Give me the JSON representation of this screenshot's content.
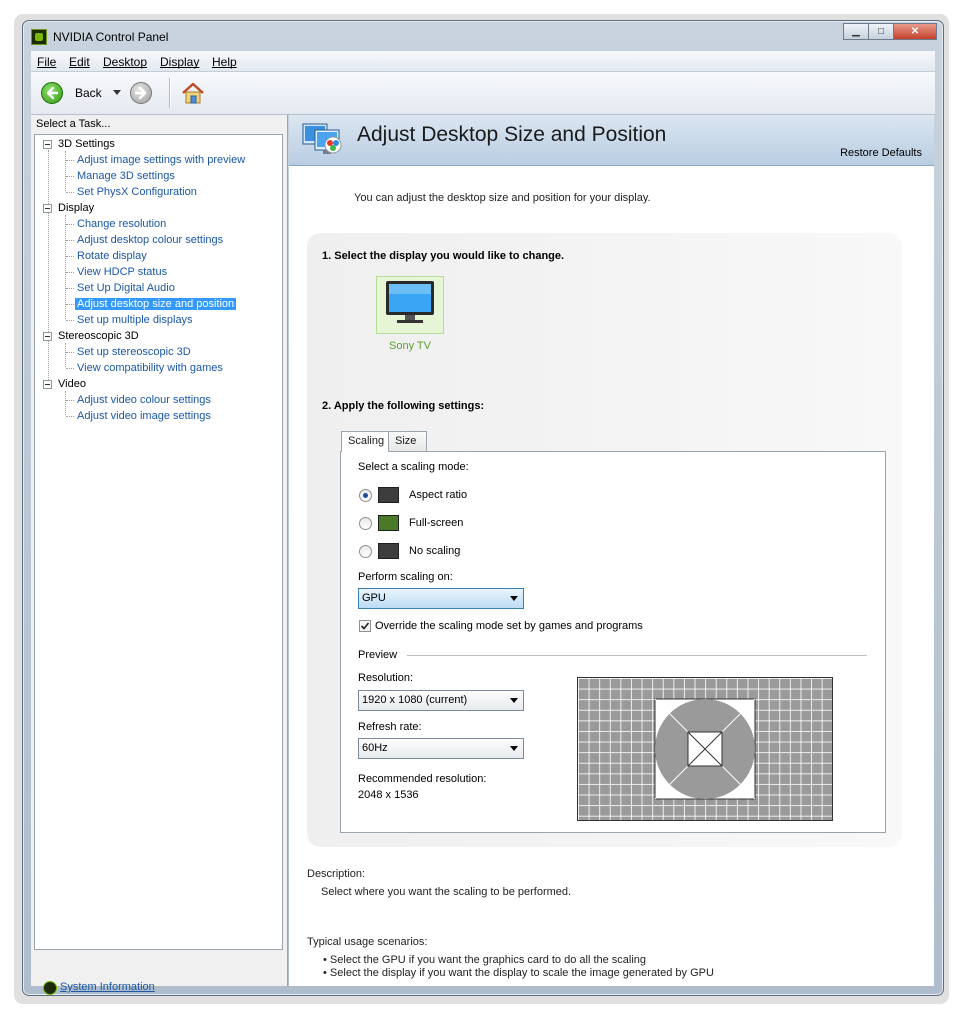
{
  "window": {
    "title": "NVIDIA Control Panel"
  },
  "menu": [
    "File",
    "Edit",
    "Desktop",
    "Display",
    "Help"
  ],
  "toolbar": {
    "back_label": "Back"
  },
  "sidebar": {
    "header": "Select a Task...",
    "categories": [
      {
        "label": "3D Settings",
        "items": [
          "Adjust image settings with preview",
          "Manage 3D settings",
          "Set PhysX Configuration"
        ]
      },
      {
        "label": "Display",
        "items": [
          "Change resolution",
          "Adjust desktop colour settings",
          "Rotate display",
          "View HDCP status",
          "Set Up Digital Audio",
          "Adjust desktop size and position",
          "Set up multiple displays"
        ]
      },
      {
        "label": "Stereoscopic 3D",
        "items": [
          "Set up stereoscopic 3D",
          "View compatibility with games"
        ]
      },
      {
        "label": "Video",
        "items": [
          "Adjust video colour settings",
          "Adjust video image settings"
        ]
      }
    ],
    "selected": "Adjust desktop size and position",
    "system_info": "System Information"
  },
  "page": {
    "title": "Adjust Desktop Size and Position",
    "restore": "Restore Defaults",
    "intro": "You can adjust the desktop size and position for your display.",
    "step1": "1. Select the display you would like to change.",
    "display_name": "Sony TV",
    "step2": "2. Apply the following settings:",
    "tabs": [
      "Scaling",
      "Size"
    ],
    "scaling_mode_label": "Select a scaling mode:",
    "modes": [
      {
        "label": "Aspect ratio",
        "selected": true
      },
      {
        "label": "Full-screen",
        "selected": false
      },
      {
        "label": "No scaling",
        "selected": false
      }
    ],
    "perform_label": "Perform scaling on:",
    "perform_value": "GPU",
    "override_label": "Override the scaling mode set by games and programs",
    "override_checked": true,
    "preview_label": "Preview",
    "resolution_label": "Resolution:",
    "resolution_value": "1920 x 1080 (current)",
    "refresh_label": "Refresh rate:",
    "refresh_value": "60Hz",
    "recommended_label": "Recommended resolution:",
    "recommended_value": "2048 x 1536",
    "description_title": "Description:",
    "description_text": "Select where you want the scaling to be performed.",
    "usage_title": "Typical usage scenarios:",
    "usage": [
      "Select the GPU if you want the graphics card to do all the scaling",
      "Select the display if you want the display to scale the image generated by GPU"
    ]
  },
  "colors": {
    "accent_green": "#76b900",
    "link_blue": "#1c57a6",
    "selection": "#3399ff"
  }
}
